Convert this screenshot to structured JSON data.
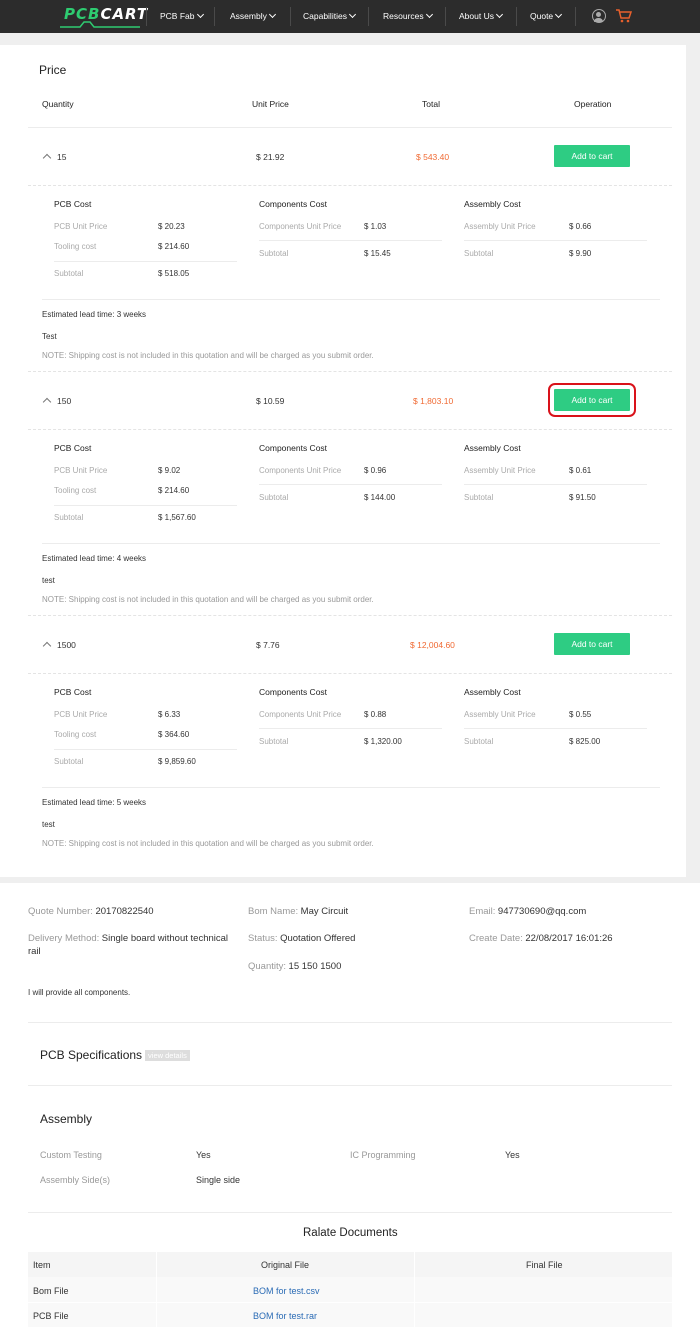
{
  "nav": {
    "logo": "PCBCART",
    "items": [
      "PCB Fab",
      "Assembly",
      "Capabilities",
      "Resources",
      "About Us",
      "Quote"
    ]
  },
  "price": {
    "title": "Price",
    "headers": {
      "quantity": "Quantity",
      "unit_price": "Unit Price",
      "total": "Total",
      "operation": "Operation"
    },
    "labels": {
      "pcb_cost": "PCB Cost",
      "components_cost": "Components Cost",
      "assembly_cost": "Assembly Cost",
      "pcb_unit_price": "PCB Unit Price",
      "tooling_cost": "Tooling cost",
      "subtotal": "Subtotal",
      "components_unit_price": "Components Unit Price",
      "assembly_unit_price": "Assembly Unit Price",
      "note": "NOTE: Shipping cost is not included in this quotation and will be charged as you submit order.",
      "add_to_cart": "Add to cart"
    },
    "rows": [
      {
        "quantity": "15",
        "unit_price": "$ 21.92",
        "total": "$ 543.40",
        "pcb_unit_price": "$ 20.23",
        "tooling_cost": "$ 214.60",
        "pcb_subtotal": "$ 518.05",
        "comp_unit_price": "$ 1.03",
        "comp_subtotal": "$ 15.45",
        "asm_unit_price": "$ 0.66",
        "asm_subtotal": "$ 9.90",
        "lead_time": "Estimated lead time: 3 weeks",
        "remark": "Test"
      },
      {
        "quantity": "150",
        "unit_price": "$ 10.59",
        "total": "$ 1,803.10",
        "pcb_unit_price": "$ 9.02",
        "tooling_cost": "$ 214.60",
        "pcb_subtotal": "$ 1,567.60",
        "comp_unit_price": "$ 0.96",
        "comp_subtotal": "$ 144.00",
        "asm_unit_price": "$ 0.61",
        "asm_subtotal": "$ 91.50",
        "lead_time": "Estimated lead time: 4 weeks",
        "remark": "test"
      },
      {
        "quantity": "1500",
        "unit_price": "$ 7.76",
        "total": "$ 12,004.60",
        "pcb_unit_price": "$ 6.33",
        "tooling_cost": "$ 364.60",
        "pcb_subtotal": "$ 9,859.60",
        "comp_unit_price": "$ 0.88",
        "comp_subtotal": "$ 1,320.00",
        "asm_unit_price": "$ 0.55",
        "asm_subtotal": "$ 825.00",
        "lead_time": "Estimated lead time: 5 weeks",
        "remark": "test"
      }
    ]
  },
  "info": {
    "quote_number_label": "Quote Number:",
    "quote_number": "20170822540",
    "bom_name_label": "Bom Name:",
    "bom_name": "May Circuit",
    "email_label": "Email:",
    "email": "947730690@qq.com",
    "delivery_label": "Delivery Method:",
    "delivery_line1": "Single board without technical",
    "delivery_line2": "rail",
    "status_label": "Status:",
    "status": "Quotation Offered",
    "create_date_label": "Create Date:",
    "create_date": "22/08/2017 16:01:26",
    "quantity_label": "Quantity:",
    "quantity": "15 150 1500",
    "components_note": "I will provide all components."
  },
  "pcb_spec": {
    "title": "PCB Specifications",
    "view_details": "view details"
  },
  "assembly": {
    "title": "Assembly",
    "custom_testing_label": "Custom Testing",
    "custom_testing": "Yes",
    "ic_programming_label": "IC Programming",
    "ic_programming": "Yes",
    "assembly_side_label": "Assembly Side(s)",
    "assembly_side": "Single side"
  },
  "documents": {
    "title": "Ralate Documents",
    "headers": [
      "Item",
      "Original File",
      "Final File"
    ],
    "rows": [
      {
        "item": "Bom File",
        "original": "BOM for test.csv",
        "final": ""
      },
      {
        "item": "PCB File",
        "original": "BOM for test.rar",
        "final": ""
      }
    ]
  },
  "colors": {
    "accent_green": "#2ecc83",
    "price_orange": "#f06a33",
    "highlight_red": "#d9121a",
    "nav_bg": "#2c2c2c"
  }
}
